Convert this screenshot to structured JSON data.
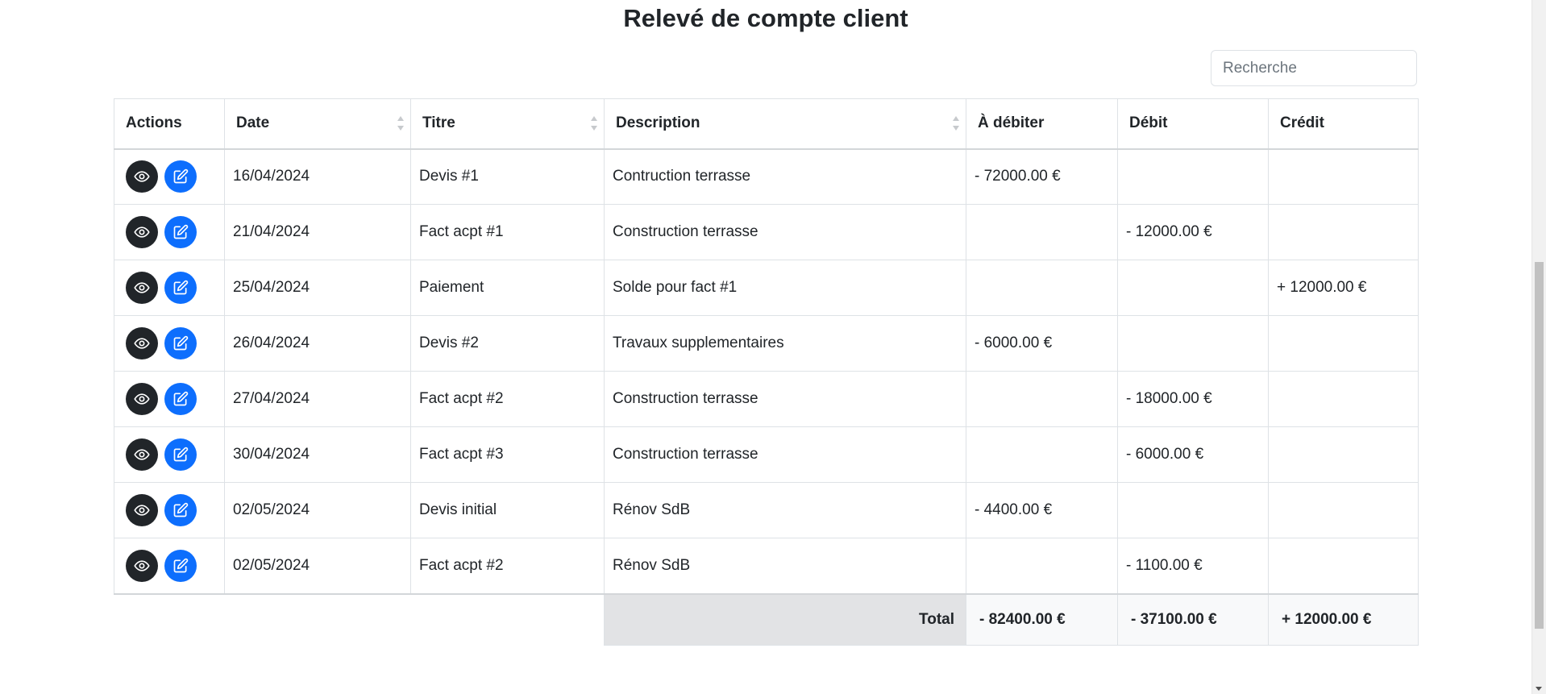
{
  "page": {
    "title": "Relevé de compte client"
  },
  "search": {
    "placeholder": "Recherche",
    "value": ""
  },
  "table": {
    "headers": {
      "actions": "Actions",
      "date": "Date",
      "titre": "Titre",
      "description": "Description",
      "a_debiter": "À débiter",
      "debit": "Débit",
      "credit": "Crédit"
    },
    "rows": [
      {
        "date": "16/04/2024",
        "titre": "Devis #1",
        "description": "Contruction terrasse",
        "a_debiter": "- 72000.00 €",
        "debit": "",
        "credit": ""
      },
      {
        "date": "21/04/2024",
        "titre": "Fact acpt #1",
        "description": "Construction terrasse",
        "a_debiter": "",
        "debit": "- 12000.00 €",
        "credit": ""
      },
      {
        "date": "25/04/2024",
        "titre": "Paiement",
        "description": "Solde pour fact #1",
        "a_debiter": "",
        "debit": "",
        "credit": "+ 12000.00 €"
      },
      {
        "date": "26/04/2024",
        "titre": "Devis #2",
        "description": "Travaux supplementaires",
        "a_debiter": "- 6000.00 €",
        "debit": "",
        "credit": ""
      },
      {
        "date": "27/04/2024",
        "titre": "Fact acpt #2",
        "description": "Construction terrasse",
        "a_debiter": "",
        "debit": "- 18000.00 €",
        "credit": ""
      },
      {
        "date": "30/04/2024",
        "titre": "Fact acpt #3",
        "description": "Construction terrasse",
        "a_debiter": "",
        "debit": "- 6000.00 €",
        "credit": ""
      },
      {
        "date": "02/05/2024",
        "titre": "Devis initial",
        "description": "Rénov SdB",
        "a_debiter": "- 4400.00 €",
        "debit": "",
        "credit": ""
      },
      {
        "date": "02/05/2024",
        "titre": "Fact acpt #2",
        "description": "Rénov SdB",
        "a_debiter": "",
        "debit": "- 1100.00 €",
        "credit": ""
      }
    ],
    "totals": {
      "label": "Total",
      "a_debiter": "- 82400.00 €",
      "debit": "- 37100.00 €",
      "credit": "+ 12000.00 €"
    }
  },
  "icons": {
    "view_button": "eye-icon",
    "edit_button": "edit-icon",
    "sort": "sort-arrows-icon"
  },
  "colors": {
    "view_button_bg": "#212529",
    "edit_button_bg": "#0d6efd",
    "total_label_bg": "#e2e3e5",
    "total_value_bg": "#f8f9fa"
  }
}
